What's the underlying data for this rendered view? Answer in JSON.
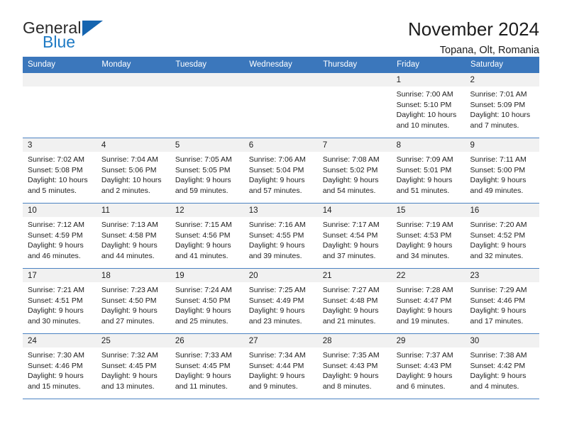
{
  "brand": {
    "name_part1": "General",
    "name_part2": "Blue",
    "triangle_icon": "triangle-logo-icon",
    "colors": {
      "dark": "#2b2b2b",
      "blue": "#1e7ac4",
      "triangle": "#1565b0"
    }
  },
  "header": {
    "title": "November 2024",
    "location": "Topana, Olt, Romania"
  },
  "colors": {
    "header_row_bg": "#3b77bc",
    "header_row_text": "#ffffff",
    "daynum_band_bg": "#f1f1f1",
    "row_border": "#4b82c2",
    "body_text": "#1d1d1d"
  },
  "calendar": {
    "weekday_headers": [
      "Sunday",
      "Monday",
      "Tuesday",
      "Wednesday",
      "Thursday",
      "Friday",
      "Saturday"
    ],
    "weeks": [
      [
        {
          "day": "",
          "lines": []
        },
        {
          "day": "",
          "lines": []
        },
        {
          "day": "",
          "lines": []
        },
        {
          "day": "",
          "lines": []
        },
        {
          "day": "",
          "lines": []
        },
        {
          "day": "1",
          "lines": [
            "Sunrise: 7:00 AM",
            "Sunset: 5:10 PM",
            "Daylight: 10 hours",
            "and 10 minutes."
          ]
        },
        {
          "day": "2",
          "lines": [
            "Sunrise: 7:01 AM",
            "Sunset: 5:09 PM",
            "Daylight: 10 hours",
            "and 7 minutes."
          ]
        }
      ],
      [
        {
          "day": "3",
          "lines": [
            "Sunrise: 7:02 AM",
            "Sunset: 5:08 PM",
            "Daylight: 10 hours",
            "and 5 minutes."
          ]
        },
        {
          "day": "4",
          "lines": [
            "Sunrise: 7:04 AM",
            "Sunset: 5:06 PM",
            "Daylight: 10 hours",
            "and 2 minutes."
          ]
        },
        {
          "day": "5",
          "lines": [
            "Sunrise: 7:05 AM",
            "Sunset: 5:05 PM",
            "Daylight: 9 hours",
            "and 59 minutes."
          ]
        },
        {
          "day": "6",
          "lines": [
            "Sunrise: 7:06 AM",
            "Sunset: 5:04 PM",
            "Daylight: 9 hours",
            "and 57 minutes."
          ]
        },
        {
          "day": "7",
          "lines": [
            "Sunrise: 7:08 AM",
            "Sunset: 5:02 PM",
            "Daylight: 9 hours",
            "and 54 minutes."
          ]
        },
        {
          "day": "8",
          "lines": [
            "Sunrise: 7:09 AM",
            "Sunset: 5:01 PM",
            "Daylight: 9 hours",
            "and 51 minutes."
          ]
        },
        {
          "day": "9",
          "lines": [
            "Sunrise: 7:11 AM",
            "Sunset: 5:00 PM",
            "Daylight: 9 hours",
            "and 49 minutes."
          ]
        }
      ],
      [
        {
          "day": "10",
          "lines": [
            "Sunrise: 7:12 AM",
            "Sunset: 4:59 PM",
            "Daylight: 9 hours",
            "and 46 minutes."
          ]
        },
        {
          "day": "11",
          "lines": [
            "Sunrise: 7:13 AM",
            "Sunset: 4:58 PM",
            "Daylight: 9 hours",
            "and 44 minutes."
          ]
        },
        {
          "day": "12",
          "lines": [
            "Sunrise: 7:15 AM",
            "Sunset: 4:56 PM",
            "Daylight: 9 hours",
            "and 41 minutes."
          ]
        },
        {
          "day": "13",
          "lines": [
            "Sunrise: 7:16 AM",
            "Sunset: 4:55 PM",
            "Daylight: 9 hours",
            "and 39 minutes."
          ]
        },
        {
          "day": "14",
          "lines": [
            "Sunrise: 7:17 AM",
            "Sunset: 4:54 PM",
            "Daylight: 9 hours",
            "and 37 minutes."
          ]
        },
        {
          "day": "15",
          "lines": [
            "Sunrise: 7:19 AM",
            "Sunset: 4:53 PM",
            "Daylight: 9 hours",
            "and 34 minutes."
          ]
        },
        {
          "day": "16",
          "lines": [
            "Sunrise: 7:20 AM",
            "Sunset: 4:52 PM",
            "Daylight: 9 hours",
            "and 32 minutes."
          ]
        }
      ],
      [
        {
          "day": "17",
          "lines": [
            "Sunrise: 7:21 AM",
            "Sunset: 4:51 PM",
            "Daylight: 9 hours",
            "and 30 minutes."
          ]
        },
        {
          "day": "18",
          "lines": [
            "Sunrise: 7:23 AM",
            "Sunset: 4:50 PM",
            "Daylight: 9 hours",
            "and 27 minutes."
          ]
        },
        {
          "day": "19",
          "lines": [
            "Sunrise: 7:24 AM",
            "Sunset: 4:50 PM",
            "Daylight: 9 hours",
            "and 25 minutes."
          ]
        },
        {
          "day": "20",
          "lines": [
            "Sunrise: 7:25 AM",
            "Sunset: 4:49 PM",
            "Daylight: 9 hours",
            "and 23 minutes."
          ]
        },
        {
          "day": "21",
          "lines": [
            "Sunrise: 7:27 AM",
            "Sunset: 4:48 PM",
            "Daylight: 9 hours",
            "and 21 minutes."
          ]
        },
        {
          "day": "22",
          "lines": [
            "Sunrise: 7:28 AM",
            "Sunset: 4:47 PM",
            "Daylight: 9 hours",
            "and 19 minutes."
          ]
        },
        {
          "day": "23",
          "lines": [
            "Sunrise: 7:29 AM",
            "Sunset: 4:46 PM",
            "Daylight: 9 hours",
            "and 17 minutes."
          ]
        }
      ],
      [
        {
          "day": "24",
          "lines": [
            "Sunrise: 7:30 AM",
            "Sunset: 4:46 PM",
            "Daylight: 9 hours",
            "and 15 minutes."
          ]
        },
        {
          "day": "25",
          "lines": [
            "Sunrise: 7:32 AM",
            "Sunset: 4:45 PM",
            "Daylight: 9 hours",
            "and 13 minutes."
          ]
        },
        {
          "day": "26",
          "lines": [
            "Sunrise: 7:33 AM",
            "Sunset: 4:45 PM",
            "Daylight: 9 hours",
            "and 11 minutes."
          ]
        },
        {
          "day": "27",
          "lines": [
            "Sunrise: 7:34 AM",
            "Sunset: 4:44 PM",
            "Daylight: 9 hours",
            "and 9 minutes."
          ]
        },
        {
          "day": "28",
          "lines": [
            "Sunrise: 7:35 AM",
            "Sunset: 4:43 PM",
            "Daylight: 9 hours",
            "and 8 minutes."
          ]
        },
        {
          "day": "29",
          "lines": [
            "Sunrise: 7:37 AM",
            "Sunset: 4:43 PM",
            "Daylight: 9 hours",
            "and 6 minutes."
          ]
        },
        {
          "day": "30",
          "lines": [
            "Sunrise: 7:38 AM",
            "Sunset: 4:42 PM",
            "Daylight: 9 hours",
            "and 4 minutes."
          ]
        }
      ]
    ]
  }
}
